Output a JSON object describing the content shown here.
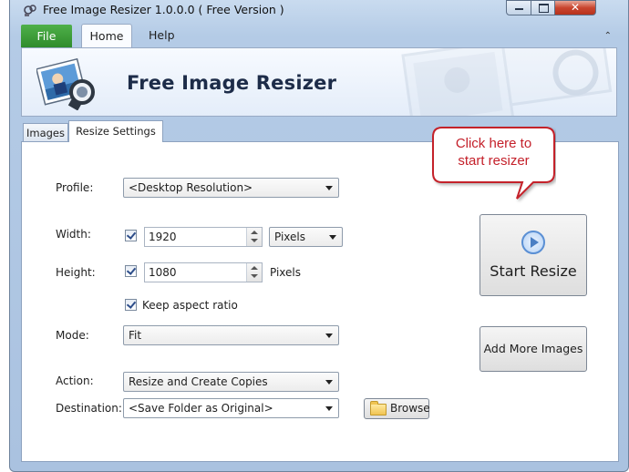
{
  "window": {
    "title": "Free Image Resizer 1.0.0.0 ( Free Version )",
    "close_glyph": "✕"
  },
  "ribbon": {
    "tabs": {
      "file": "File",
      "home": "Home",
      "help": "Help"
    },
    "collapse_glyph": "⌃",
    "app_title": "Free Image Resizer"
  },
  "tabs": {
    "images": "Images",
    "resize_settings": "Resize Settings"
  },
  "form": {
    "profile_label": "Profile:",
    "profile_value": "<Desktop Resolution>",
    "width_label": "Width:",
    "width_checked": true,
    "width_value": "1920",
    "width_unit": "Pixels",
    "height_label": "Height:",
    "height_checked": true,
    "height_value": "1080",
    "height_unit": "Pixels",
    "keep_aspect_checked": true,
    "keep_aspect_label": "Keep aspect ratio",
    "mode_label": "Mode:",
    "mode_value": "Fit",
    "action_label": "Action:",
    "action_value": "Resize and Create Copies",
    "destination_label": "Destination:",
    "destination_value": "<Save Folder as Original>",
    "browse_label": "Browse"
  },
  "buttons": {
    "start_resize": "Start Resize",
    "add_more_images": "Add More Images"
  },
  "callout": {
    "line1": "Click here to",
    "line2": "start resizer",
    "color": "#c4202a"
  }
}
